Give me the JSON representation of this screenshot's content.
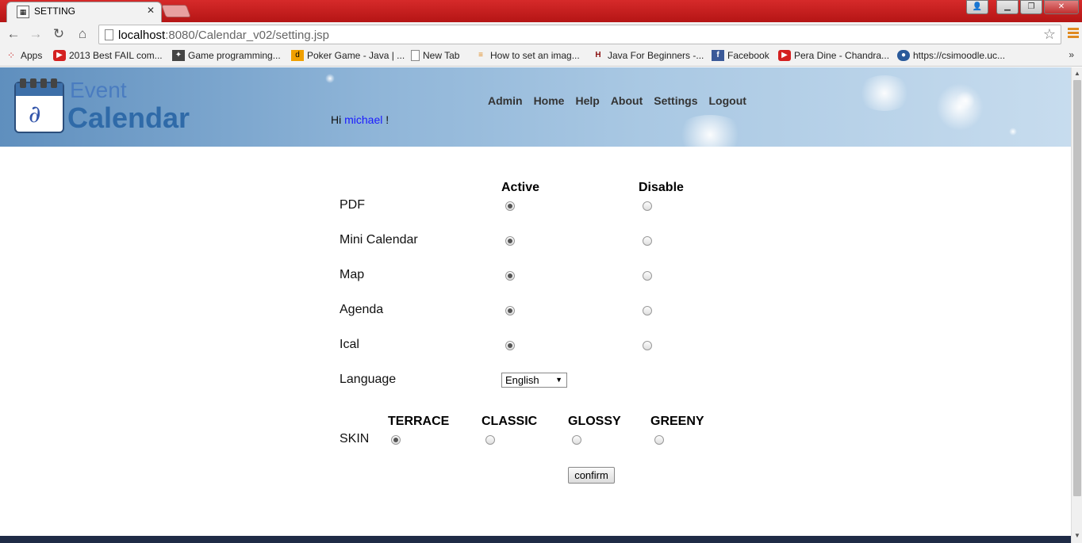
{
  "browser": {
    "tab_title": "SETTING",
    "url_host": "localhost",
    "url_rest": ":8080/Calendar_v02/setting.jsp",
    "bookmarks": [
      {
        "label": "Apps",
        "icon": "apps-grid-icon"
      },
      {
        "label": "2013 Best FAIL com...",
        "icon": "youtube-icon"
      },
      {
        "label": "Game programming...",
        "icon": "game-icon"
      },
      {
        "label": "Poker Game - Java | ...",
        "icon": "dzone-icon"
      },
      {
        "label": "New Tab",
        "icon": "page-icon"
      },
      {
        "label": "How to set an imag...",
        "icon": "stackoverflow-icon"
      },
      {
        "label": "Java For Beginners -...",
        "icon": "hl-icon"
      },
      {
        "label": "Facebook",
        "icon": "facebook-icon"
      },
      {
        "label": "Pera Dine - Chandra...",
        "icon": "youtube-icon"
      },
      {
        "label": "https://csimoodle.uc...",
        "icon": "moodle-icon"
      }
    ],
    "more": "»"
  },
  "header": {
    "logo_event": "Event",
    "logo_calendar": "Calendar",
    "greeting_prefix": "Hi",
    "username": "michael",
    "greeting_suffix": "!",
    "menu": [
      "Admin",
      "Home",
      "Help",
      "About",
      "Settings",
      "Logout"
    ]
  },
  "settings": {
    "col_active": "Active",
    "col_disable": "Disable",
    "rows": [
      {
        "label": "PDF",
        "value": "Active"
      },
      {
        "label": "Mini Calendar",
        "value": "Active"
      },
      {
        "label": "Map",
        "value": "Active"
      },
      {
        "label": "Agenda",
        "value": "Active"
      },
      {
        "label": "Ical",
        "value": "Active"
      }
    ],
    "language_label": "Language",
    "language_value": "English",
    "skin_label": "SKIN",
    "skins": [
      "TERRACE",
      "CLASSIC",
      "GLOSSY",
      "GREENY"
    ],
    "skin_selected": "TERRACE",
    "confirm_label": "confirm"
  }
}
